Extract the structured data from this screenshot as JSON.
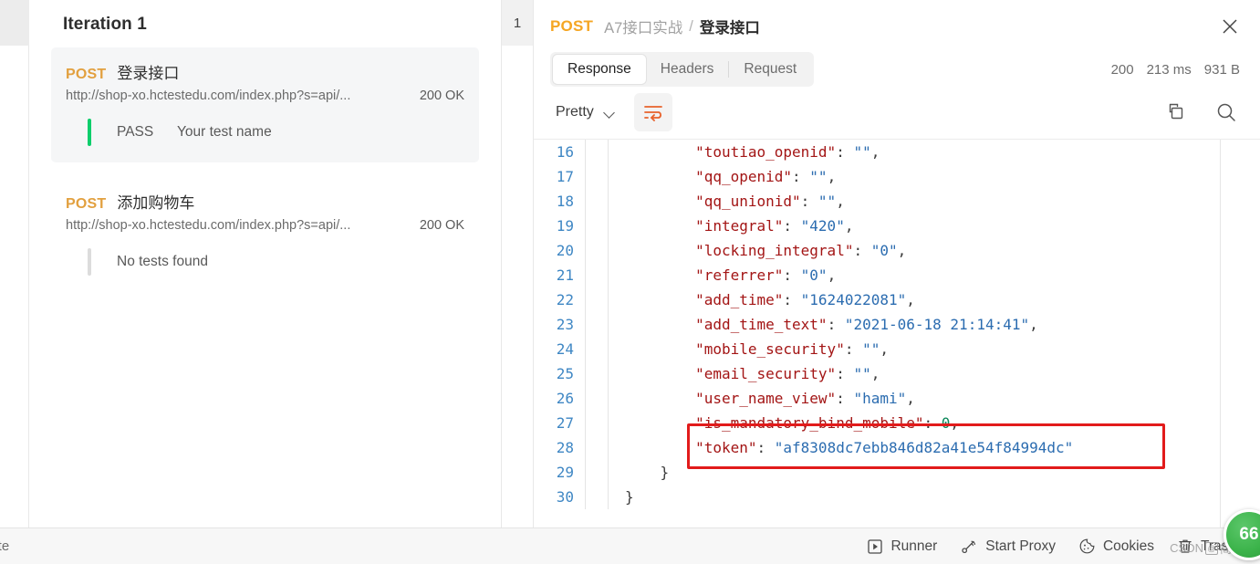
{
  "left_panel": {
    "iteration_title": "Iteration 1",
    "requests": [
      {
        "method": "POST",
        "name": "登录接口",
        "url": "http://shop-xo.hctestedu.com/index.php?s=api/...",
        "status": "200 OK",
        "test_verdict": "PASS",
        "test_label": "Your test name",
        "verdict_type": "pass"
      },
      {
        "method": "POST",
        "name": "添加购物车",
        "url": "http://shop-xo.hctestedu.com/index.php?s=api/...",
        "status": "200 OK",
        "test_verdict": "",
        "test_label": "No tests found",
        "verdict_type": "none"
      }
    ]
  },
  "iteration_column": {
    "index_label": "1"
  },
  "response_panel": {
    "breadcrumb": {
      "method": "POST",
      "parent": "A7接口实战",
      "separator": "/",
      "current": "登录接口"
    },
    "close_label": "×",
    "tabs": [
      {
        "label": "Response",
        "active": true
      },
      {
        "label": "Headers",
        "active": false
      },
      {
        "label": "Request",
        "active": false
      }
    ],
    "meta": {
      "status_code": "200",
      "time": "213 ms",
      "size": "931 B"
    },
    "toolbar": {
      "format_label": "Pretty",
      "wrap_icon": "word-wrap-icon",
      "copy_icon": "copy-icon",
      "search_icon": "search-icon"
    }
  },
  "code": {
    "language": "json",
    "lines": [
      {
        "no": "16",
        "indent": 2,
        "key": "toutiao_openid",
        "value": "\"\"",
        "type": "string",
        "comma": true
      },
      {
        "no": "17",
        "indent": 2,
        "key": "qq_openid",
        "value": "\"\"",
        "type": "string",
        "comma": true
      },
      {
        "no": "18",
        "indent": 2,
        "key": "qq_unionid",
        "value": "\"\"",
        "type": "string",
        "comma": true
      },
      {
        "no": "19",
        "indent": 2,
        "key": "integral",
        "value": "\"420\"",
        "type": "string",
        "comma": true
      },
      {
        "no": "20",
        "indent": 2,
        "key": "locking_integral",
        "value": "\"0\"",
        "type": "string",
        "comma": true
      },
      {
        "no": "21",
        "indent": 2,
        "key": "referrer",
        "value": "\"0\"",
        "type": "string",
        "comma": true
      },
      {
        "no": "22",
        "indent": 2,
        "key": "add_time",
        "value": "\"1624022081\"",
        "type": "string",
        "comma": true
      },
      {
        "no": "23",
        "indent": 2,
        "key": "add_time_text",
        "value": "\"2021-06-18 21:14:41\"",
        "type": "string",
        "comma": true
      },
      {
        "no": "24",
        "indent": 2,
        "key": "mobile_security",
        "value": "\"\"",
        "type": "string",
        "comma": true
      },
      {
        "no": "25",
        "indent": 2,
        "key": "email_security",
        "value": "\"\"",
        "type": "string",
        "comma": true
      },
      {
        "no": "26",
        "indent": 2,
        "key": "user_name_view",
        "value": "\"hami\"",
        "type": "string",
        "comma": true
      },
      {
        "no": "27",
        "indent": 2,
        "key": "is_mandatory_bind_mobile",
        "value": "0",
        "type": "number",
        "comma": true
      },
      {
        "no": "28",
        "indent": 2,
        "key": "token",
        "value": "\"af8308dc7ebb846d82a41e54f84994dc\"",
        "type": "string",
        "comma": false
      },
      {
        "no": "29",
        "indent": 1,
        "brace": "}",
        "comma": false
      },
      {
        "no": "30",
        "indent": 0,
        "brace": "}",
        "comma": false
      }
    ],
    "highlight": {
      "color": "#e21b1b",
      "target_line": "28",
      "note": "token value highlighted with red rectangle"
    }
  },
  "bottom_bar": {
    "left_text": "lete",
    "items": [
      {
        "label": "Runner",
        "icon": "play-box-icon"
      },
      {
        "label": "Start Proxy",
        "icon": "proxy-icon"
      },
      {
        "label": "Cookies",
        "icon": "cookie-icon"
      },
      {
        "label": "Trash",
        "icon": "trash-icon"
      }
    ]
  },
  "overlays": {
    "watermark_text": "CSDN",
    "watermark_logo": "@",
    "watermark_author": "简丹",
    "badge_number": "66"
  },
  "colors": {
    "method_orange": "#e2a03f",
    "pass_green": "#0cce6b",
    "highlight_red": "#e21b1b",
    "badge_green": "#3bb34a",
    "json_key": "#a31515",
    "json_string": "#2b6cb0",
    "json_number": "#098658",
    "lineno_blue": "#3f87c4"
  }
}
